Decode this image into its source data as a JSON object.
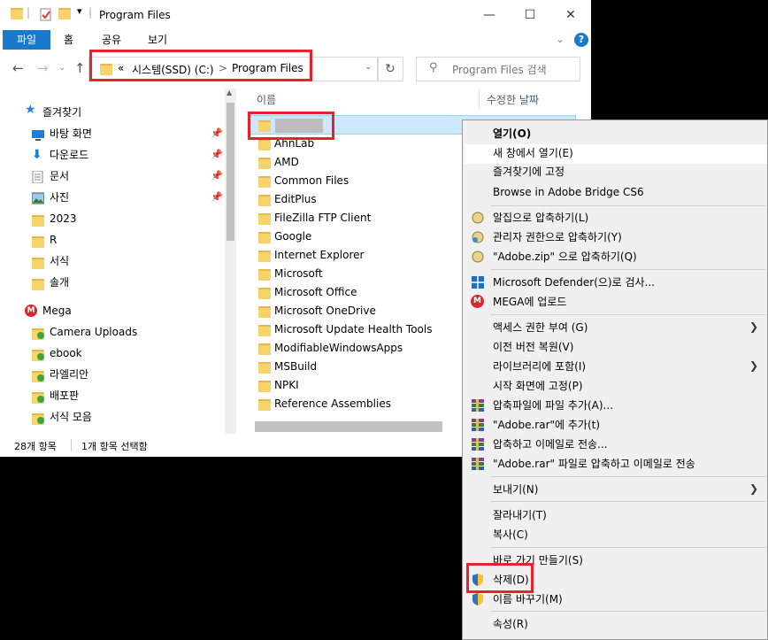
{
  "window": {
    "title": "Program Files",
    "ribbon_tabs": [
      "파일",
      "홈",
      "공유",
      "보기"
    ],
    "help_label": "?"
  },
  "address": {
    "prefix": "«",
    "segments": [
      "시스템(SSD) (C:)",
      "Program Files"
    ],
    "separator": ">",
    "search_placeholder": "Program Files 검색"
  },
  "nav": {
    "items": [
      {
        "label": "즐겨찾기",
        "icon": "star-icon",
        "pinned": false
      },
      {
        "label": "바탕 화면",
        "icon": "desktop-icon",
        "pinned": true
      },
      {
        "label": "다운로드",
        "icon": "download-icon",
        "pinned": true
      },
      {
        "label": "문서",
        "icon": "documents-icon",
        "pinned": true
      },
      {
        "label": "사진",
        "icon": "pictures-icon",
        "pinned": true
      },
      {
        "label": "2023",
        "icon": "folder-icon",
        "pinned": false
      },
      {
        "label": "R",
        "icon": "folder-icon",
        "pinned": false
      },
      {
        "label": "서식",
        "icon": "folder-icon",
        "pinned": false
      },
      {
        "label": "솔개",
        "icon": "folder-icon",
        "pinned": false
      },
      {
        "label": "Mega",
        "icon": "mega-icon",
        "pinned": false
      },
      {
        "label": "Camera Uploads",
        "icon": "synced-folder-icon",
        "pinned": false
      },
      {
        "label": "ebook",
        "icon": "synced-folder-icon",
        "pinned": false
      },
      {
        "label": "라엘리안",
        "icon": "synced-folder-icon",
        "pinned": false
      },
      {
        "label": "배포판",
        "icon": "synced-folder-icon",
        "pinned": false
      },
      {
        "label": "서식 모음",
        "icon": "synced-folder-icon",
        "pinned": false
      }
    ]
  },
  "files": {
    "columns": [
      "이름",
      "수정한 날짜"
    ],
    "rows": [
      "",
      "AhnLab",
      "AMD",
      "Common Files",
      "EditPlus",
      "FileZilla FTP Client",
      "Google",
      "Internet Explorer",
      "Microsoft",
      "Microsoft Office",
      "Microsoft OneDrive",
      "Microsoft Update Health Tools",
      "ModifiableWindowsApps",
      "MSBuild",
      "NPKI",
      "Reference Assemblies"
    ]
  },
  "status": {
    "count": "28개 항목",
    "selected": "1개 항목 선택함"
  },
  "context_menu": {
    "groups": [
      [
        {
          "label": "열기(O)",
          "bold": true
        },
        {
          "label": "새 창에서 열기(E)",
          "highlight": true
        },
        {
          "label": "즐겨찾기에 고정"
        },
        {
          "label": "Browse in Adobe Bridge CS6"
        }
      ],
      [
        {
          "label": "알집으로 압축하기(L)",
          "icon": "alzip-icon"
        },
        {
          "label": "관리자 권한으로 압축하기(Y)",
          "icon": "alzip-admin-icon"
        },
        {
          "label": "\"Adobe.zip\" 으로 압축하기(Q)",
          "icon": "alzip-icon"
        }
      ],
      [
        {
          "label": "Microsoft Defender(으)로 검사...",
          "icon": "defender-icon"
        },
        {
          "label": "MEGA에 업로드",
          "icon": "mega-icon"
        }
      ],
      [
        {
          "label": "액세스 권한 부여 (G)",
          "submenu": true
        },
        {
          "label": "이전 버전 복원(V)"
        },
        {
          "label": "라이브러리에 포함(I)",
          "submenu": true
        },
        {
          "label": "시작 화면에 고정(P)"
        },
        {
          "label": "압축파일에 파일 추가(A)...",
          "icon": "winrar-icon"
        },
        {
          "label": "\"Adobe.rar\"에 추가(t)",
          "icon": "winrar-icon"
        },
        {
          "label": "압축하고 이메일로 전송...",
          "icon": "winrar-icon"
        },
        {
          "label": "\"Adobe.rar\" 파일로 압축하고 이메일로 전송",
          "icon": "winrar-icon"
        }
      ],
      [
        {
          "label": "보내기(N)",
          "submenu": true
        }
      ],
      [
        {
          "label": "잘라내기(T)"
        },
        {
          "label": "복사(C)"
        }
      ],
      [
        {
          "label": "바로 가기 만들기(S)"
        },
        {
          "label": "삭제(D)",
          "icon": "shield-icon"
        },
        {
          "label": "이름 바꾸기(M)",
          "icon": "shield-icon"
        }
      ],
      [
        {
          "label": "속성(R)"
        }
      ]
    ]
  },
  "colors": {
    "accent": "#1979ca",
    "selection": "#cce8ff",
    "highlight_box": "#e8222b",
    "folder": "#f6d36b"
  }
}
